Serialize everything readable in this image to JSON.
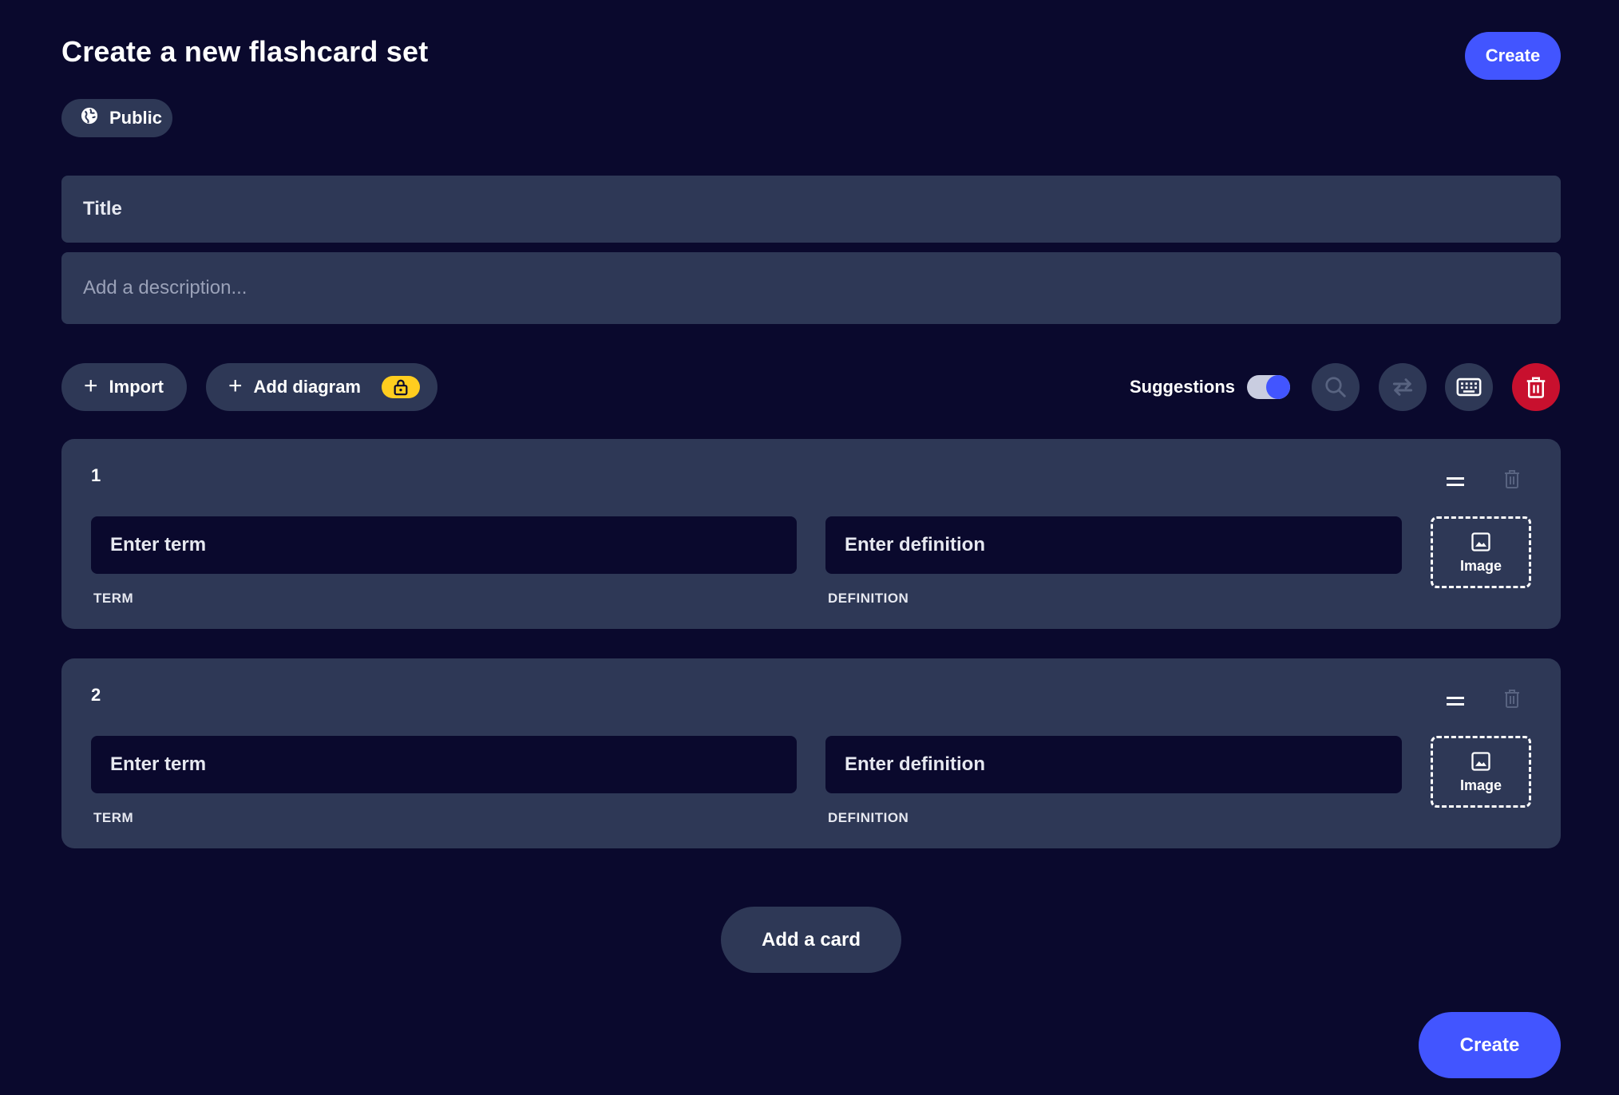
{
  "header": {
    "title": "Create a new flashcard set",
    "create_label": "Create"
  },
  "visibility": {
    "label": "Public",
    "icon": "globe-icon"
  },
  "title_field": {
    "placeholder": "Title",
    "value": ""
  },
  "description_field": {
    "placeholder": "Add a description...",
    "value": ""
  },
  "toolbar": {
    "import_label": "Import",
    "add_diagram_label": "Add diagram",
    "suggestions_label": "Suggestions",
    "suggestions_enabled": true,
    "icons": [
      "search-icon",
      "swap-icon",
      "keyboard-icon",
      "trash-icon"
    ]
  },
  "cards": [
    {
      "number": "1",
      "term_placeholder": "Enter term",
      "definition_placeholder": "Enter definition",
      "term_label": "TERM",
      "definition_label": "DEFINITION",
      "image_label": "Image"
    },
    {
      "number": "2",
      "term_placeholder": "Enter term",
      "definition_placeholder": "Enter definition",
      "term_label": "TERM",
      "definition_label": "DEFINITION",
      "image_label": "Image"
    }
  ],
  "footer": {
    "add_card_label": "Add a card",
    "create_label": "Create"
  },
  "colors": {
    "background": "#0a092d",
    "surface": "#2e3856",
    "accent": "#4255ff",
    "danger": "#c8102e",
    "lock_badge": "#ffcd1f"
  }
}
